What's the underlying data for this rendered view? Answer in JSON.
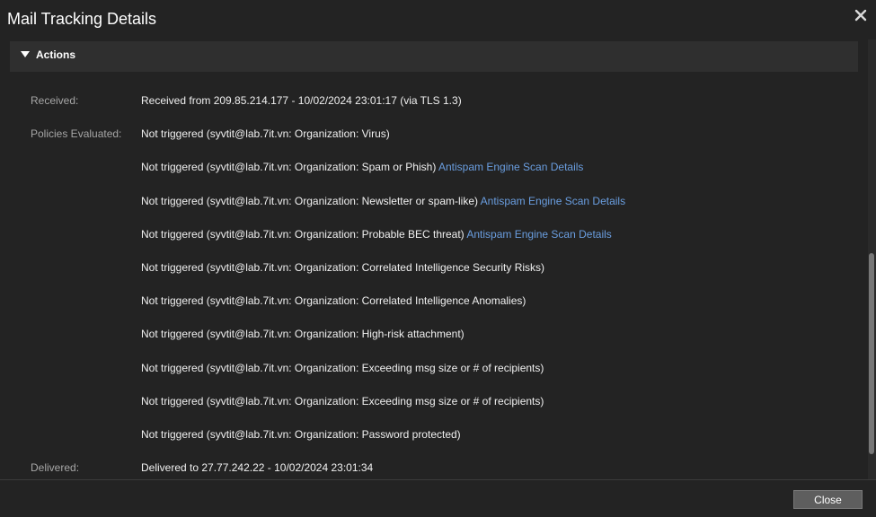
{
  "dialog": {
    "title": "Mail Tracking Details",
    "close_icon": "close-icon"
  },
  "section": {
    "title": "Actions",
    "caret_icon": "caret-down-icon"
  },
  "rows": [
    {
      "label": "Received:",
      "text": "Received from 209.85.214.177 - 10/02/2024 23:01:17 (via TLS 1.3)",
      "link": ""
    },
    {
      "label": "Policies Evaluated:",
      "text": "Not triggered (syvtit@lab.7it.vn: Organization: Virus)",
      "link": ""
    },
    {
      "label": "",
      "text": "Not triggered (syvtit@lab.7it.vn: Organization: Spam or Phish) ",
      "link": "Antispam Engine Scan Details"
    },
    {
      "label": "",
      "text": "Not triggered (syvtit@lab.7it.vn: Organization: Newsletter or spam-like) ",
      "link": "Antispam Engine Scan Details"
    },
    {
      "label": "",
      "text": "Not triggered (syvtit@lab.7it.vn: Organization: Probable BEC threat) ",
      "link": "Antispam Engine Scan Details"
    },
    {
      "label": "",
      "text": "Not triggered (syvtit@lab.7it.vn: Organization: Correlated Intelligence Security Risks)",
      "link": ""
    },
    {
      "label": "",
      "text": "Not triggered (syvtit@lab.7it.vn: Organization: Correlated Intelligence Anomalies)",
      "link": ""
    },
    {
      "label": "",
      "text": "Not triggered (syvtit@lab.7it.vn: Organization: High-risk attachment)",
      "link": ""
    },
    {
      "label": "",
      "text": "Not triggered (syvtit@lab.7it.vn: Organization: Exceeding msg size or # of recipients)",
      "link": ""
    },
    {
      "label": "",
      "text": "Not triggered (syvtit@lab.7it.vn: Organization: Exceeding msg size or # of recipients)",
      "link": ""
    },
    {
      "label": "",
      "text": "Not triggered (syvtit@lab.7it.vn: Organization: Password protected)",
      "link": ""
    },
    {
      "label": "Delivered:",
      "text": "Delivered to 27.77.242.22 - 10/02/2024 23:01:34",
      "link": ""
    }
  ],
  "footer": {
    "close_label": "Close"
  },
  "colors": {
    "background": "#232323",
    "section_bar": "#2f2f2f",
    "label": "#a6a6a6",
    "text": "#f0f0f0",
    "link": "#6a9ee0"
  }
}
